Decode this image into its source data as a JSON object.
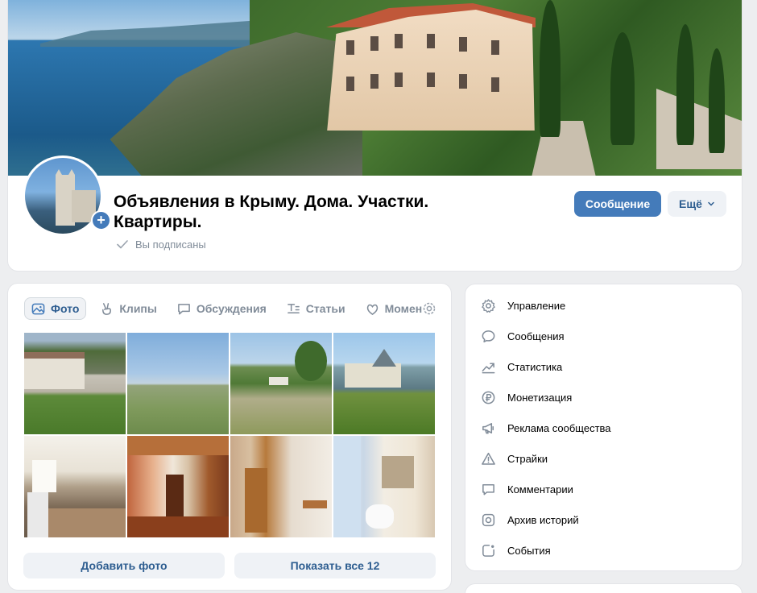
{
  "community": {
    "title": "Объявления в Крыму. Дома. Участки. Квартиры.",
    "subscription_status": "Вы подписаны"
  },
  "actions": {
    "message_label": "Сообщение",
    "more_label": "Ещё"
  },
  "photos": {
    "tabs": [
      {
        "label": "Фото",
        "icon": "photo-icon",
        "active": true
      },
      {
        "label": "Клипы",
        "icon": "clips-icon",
        "active": false
      },
      {
        "label": "Обсуждения",
        "icon": "discussion-icon",
        "active": false
      },
      {
        "label": "Статьи",
        "icon": "articles-icon",
        "active": false
      },
      {
        "label": "Момен",
        "icon": "moments-icon",
        "active": false
      }
    ],
    "thumbnails_count": 8,
    "add_photo_label": "Добавить фото",
    "show_all_label": "Показать все 12"
  },
  "admin_menu": {
    "items": [
      {
        "label": "Управление",
        "icon": "gear-icon"
      },
      {
        "label": "Сообщения",
        "icon": "chat-bubble-icon"
      },
      {
        "label": "Статистика",
        "icon": "trend-chart-icon"
      },
      {
        "label": "Монетизация",
        "icon": "ruble-icon"
      },
      {
        "label": "Реклама сообщества",
        "icon": "megaphone-icon"
      },
      {
        "label": "Страйки",
        "icon": "warning-triangle-icon"
      },
      {
        "label": "Комментарии",
        "icon": "comment-icon"
      },
      {
        "label": "Архив историй",
        "icon": "stories-archive-icon"
      },
      {
        "label": "События",
        "icon": "event-icon"
      }
    ]
  },
  "colors": {
    "accent": "#447bba",
    "link": "#2d5d90",
    "muted": "#818c99",
    "page_bg": "#edeef0"
  }
}
